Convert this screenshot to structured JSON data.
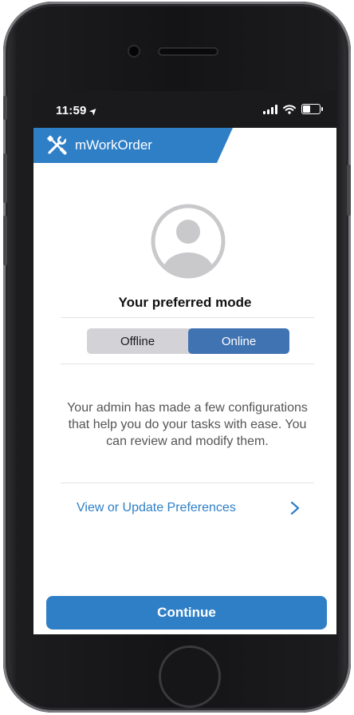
{
  "statusbar": {
    "time": "11:59",
    "location_icon": "location-arrow-icon",
    "signal_icon": "cellular-signal-icon",
    "wifi_icon": "wifi-icon",
    "battery_icon": "battery-icon"
  },
  "app": {
    "title": "mWorkOrder",
    "logo_icon": "tools-icon",
    "accent_color": "#2f7fc7"
  },
  "profile": {
    "avatar_icon": "user-avatar-icon"
  },
  "mode": {
    "heading": "Your preferred mode",
    "options": [
      "Offline",
      "Online"
    ],
    "selected": "Online"
  },
  "info": {
    "text": "Your admin has made a few configurations that help you do your tasks with ease. You can review and modify them."
  },
  "preferences": {
    "link_label": "View or Update Preferences",
    "chevron_icon": "chevron-right-icon"
  },
  "actions": {
    "continue_label": "Continue"
  }
}
